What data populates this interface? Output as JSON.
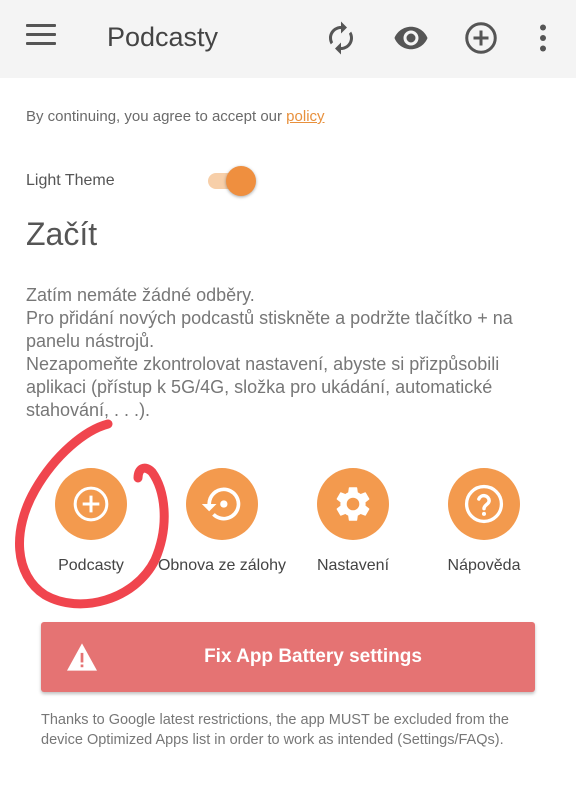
{
  "appbar": {
    "title": "Podcasty",
    "icons": [
      "menu-icon",
      "refresh-icon",
      "eye-icon",
      "add-circle-icon",
      "more-vert-icon"
    ]
  },
  "agreement": {
    "text": "By continuing, you agree to accept our",
    "link": "policy"
  },
  "theme": {
    "label": "Light Theme",
    "enabled": true
  },
  "start": {
    "heading": "Začít",
    "lines": [
      "Zatím nemáte žádné odběry.",
      "Pro přidání nových podcastů stiskněte a podržte tlačítko + na panelu nástrojů.",
      "Nezapomeňte zkontrolovat nastavení, abyste si přizpůsobili aplikaci (přístup k 5G/4G, složka pro ukádání, automatické stahování, . . .)."
    ]
  },
  "actions": [
    {
      "label": "Podcasty",
      "icon": "add-icon"
    },
    {
      "label": "Obnova ze zálohy",
      "icon": "restore-icon"
    },
    {
      "label": "Nastavení",
      "icon": "settings-icon"
    },
    {
      "label": "Nápověda",
      "icon": "help-icon"
    }
  ],
  "battery_button": {
    "label": "Fix App Battery settings",
    "icon": "warning-icon"
  },
  "note": "Thanks to Google latest restrictions, the app MUST be excluded from the device Optimized Apps list in order to work as intended (Settings/FAQs).",
  "colors": {
    "accent": "#f39a4e",
    "battery": "#e57373",
    "marker": "#f0454e"
  }
}
